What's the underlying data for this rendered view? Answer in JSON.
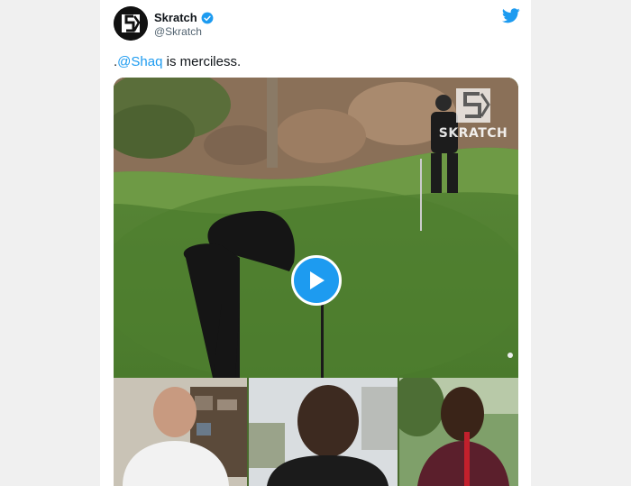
{
  "account": {
    "display_name": "Skratch",
    "handle": "@Skratch",
    "verified": true,
    "logo_icon": "skratch-logo-icon"
  },
  "platform_icon": "twitter-bird-icon",
  "tweet": {
    "prefix": ".",
    "mention": "@Shaq",
    "text": " is merciless."
  },
  "media": {
    "type": "video",
    "watermark": "SKRATCH",
    "play_icon": "play-icon",
    "panels": [
      "webcam-panel-left",
      "webcam-panel-center",
      "webcam-panel-right"
    ]
  },
  "colors": {
    "accent": "#1d9bf0",
    "text": "#0f1419",
    "muted": "#536471"
  }
}
